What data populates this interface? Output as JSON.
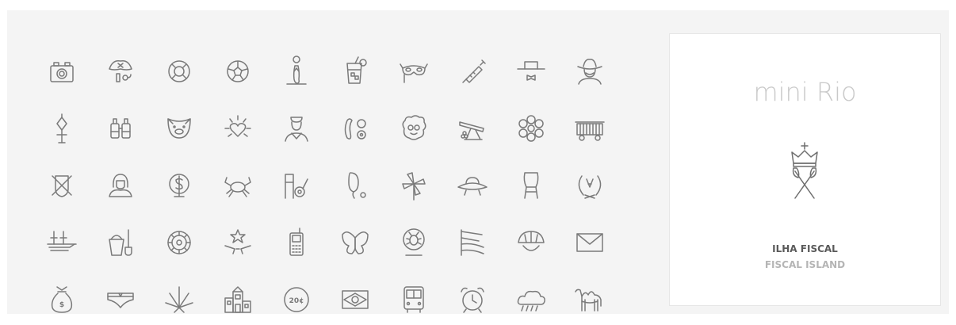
{
  "icons": [
    "camera-icon",
    "pirate-hat-icon",
    "life-buoy-icon",
    "soccer-ball-icon",
    "flip-flop-icon",
    "cocktail-glass-icon",
    "carnival-mask-icon",
    "syringe-icon",
    "hat-bowtie-icon",
    "cowboy-man-icon",
    "street-lamp-icon",
    "binoculars-icon",
    "pig-icon",
    "sacred-heart-icon",
    "sailor-man-icon",
    "earring-icon",
    "curly-hair-face-icon",
    "cannon-icon",
    "flower-icon",
    "tram-icon",
    "crossed-shield-icon",
    "hijab-woman-icon",
    "money-tree-icon",
    "crab-icon",
    "guitar-chair-icon",
    "balloon-icon",
    "pinwheel-icon",
    "ufo-icon",
    "chair-icon",
    "wreath-emblem-icon",
    "ship-icon",
    "bucket-spade-icon",
    "roulette-icon",
    "star-guns-icon",
    "mobile-phone-icon",
    "butterfly-icon",
    "bug-badge-icon",
    "striped-flag-icon",
    "bicycle-helmet-icon",
    "envelope-icon",
    "money-bag-icon",
    "swim-briefs-icon",
    "cannabis-leaf-icon",
    "favela-houses-icon",
    "coin-20-icon",
    "brazil-flag-icon",
    "bus-icon",
    "alarm-clock-icon",
    "cloud-icon",
    "camel-icon"
  ],
  "coin_label": "20¢",
  "money_label": "$",
  "detail": {
    "title": "mini Rio",
    "icon": "crown-oars-icon",
    "name": "ILHA FISCAL",
    "subtitle": "FISCAL ISLAND"
  }
}
